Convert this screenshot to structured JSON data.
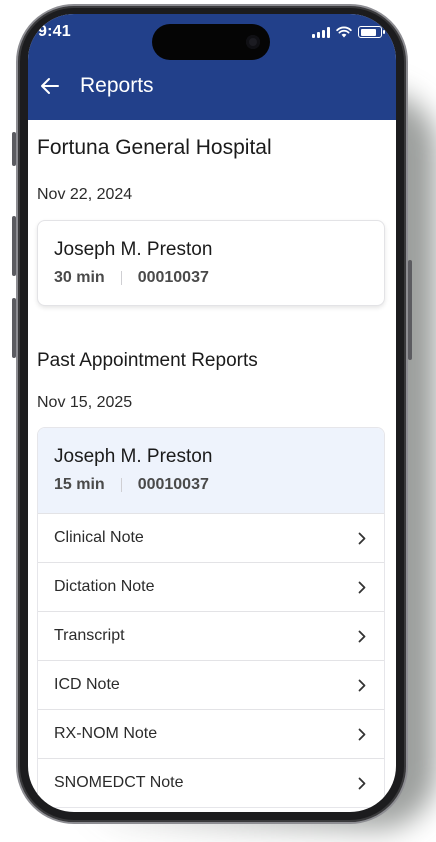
{
  "status_bar": {
    "time": "9:41"
  },
  "header": {
    "title": "Reports"
  },
  "hospital_name": "Fortuna General Hospital",
  "upcoming": {
    "date": "Nov 22, 2024",
    "patient": "Joseph M. Preston",
    "duration": "30 min",
    "record_id": "00010037"
  },
  "past_section": {
    "title": "Past Appointment Reports",
    "date": "Nov 15, 2025",
    "patient": "Joseph M. Preston",
    "duration": "15 min",
    "record_id": "00010037",
    "reports": [
      {
        "label": "Clinical Note"
      },
      {
        "label": "Dictation Note"
      },
      {
        "label": "Transcript"
      },
      {
        "label": "ICD Note"
      },
      {
        "label": "RX-NOM Note"
      },
      {
        "label": "SNOMEDCT Note"
      }
    ]
  },
  "colors": {
    "header": "#22408a",
    "highlight": "#eef3fc"
  },
  "icons": {
    "back": "arrow-left-icon",
    "row": "chevron-right-icon"
  }
}
